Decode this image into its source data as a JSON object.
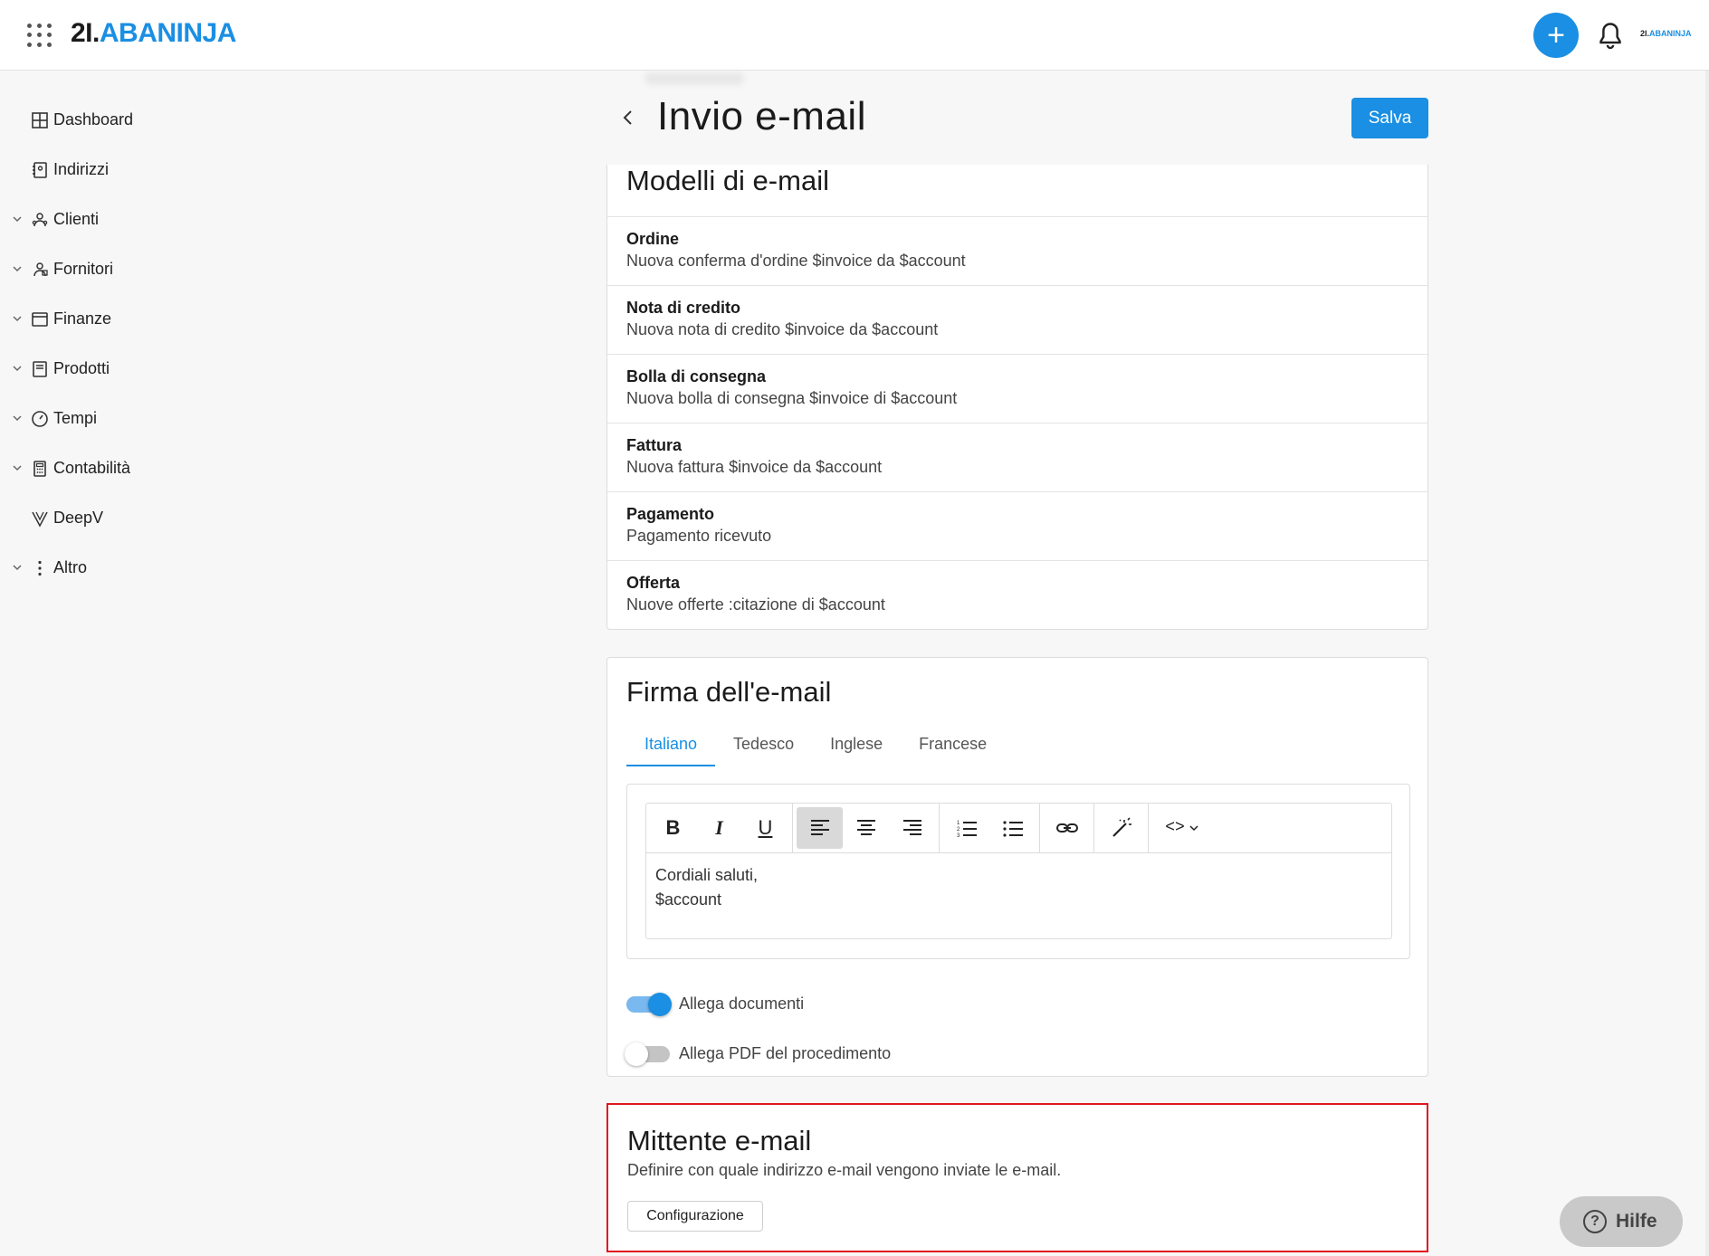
{
  "header": {
    "logo_prefix": "2I.",
    "logo_brand": "ABANINJA",
    "mini_logo_prefix": "2I.",
    "mini_logo_brand": "ABANINJA",
    "add_label": "+"
  },
  "sidebar": {
    "items": [
      {
        "label": "Dashboard",
        "icon": "dashboard-icon",
        "expandable": false
      },
      {
        "label": "Indirizzi",
        "icon": "address-book-icon",
        "expandable": false
      },
      {
        "label": "Clienti",
        "icon": "customers-icon",
        "expandable": true
      },
      {
        "label": "Fornitori",
        "icon": "suppliers-icon",
        "expandable": true
      },
      {
        "label": "Finanze",
        "icon": "finance-icon",
        "expandable": true
      },
      {
        "label": "Prodotti",
        "icon": "products-icon",
        "expandable": true
      },
      {
        "label": "Tempi",
        "icon": "clock-icon",
        "expandable": true
      },
      {
        "label": "Contabilità",
        "icon": "calculator-icon",
        "expandable": true
      },
      {
        "label": "DeepV",
        "icon": "deepv-icon",
        "expandable": false
      },
      {
        "label": "Altro",
        "icon": "more-vertical-icon",
        "expandable": true
      }
    ]
  },
  "page": {
    "title": "Invio e-mail",
    "save_label": "Salva"
  },
  "templates": {
    "title": "Modelli di e-mail",
    "rows": [
      {
        "name": "Ordine",
        "subject": "Nuova conferma d'ordine $invoice da $account"
      },
      {
        "name": "Nota di credito",
        "subject": "Nuova nota di credito $invoice da $account"
      },
      {
        "name": "Bolla di consegna",
        "subject": "Nuova bolla di consegna $invoice di $account"
      },
      {
        "name": "Fattura",
        "subject": "Nuova fattura $invoice da $account"
      },
      {
        "name": "Pagamento",
        "subject": "Pagamento ricevuto"
      },
      {
        "name": "Offerta",
        "subject": "Nuove offerte :citazione di $account"
      }
    ]
  },
  "signature": {
    "title": "Firma dell'e-mail",
    "tabs": [
      {
        "label": "Italiano",
        "active": true
      },
      {
        "label": "Tedesco",
        "active": false
      },
      {
        "label": "Inglese",
        "active": false
      },
      {
        "label": "Francese",
        "active": false
      }
    ],
    "toolbar": {
      "bold": "B",
      "italic": "I",
      "underline": "U",
      "code_label": "<>"
    },
    "text_line1": "Cordiali saluti,",
    "text_line2": "$account",
    "toggles": [
      {
        "label": "Allega documenti",
        "on": true
      },
      {
        "label": "Allega PDF del procedimento",
        "on": false
      }
    ]
  },
  "sender": {
    "title": "Mittente e-mail",
    "description": "Definire con quale indirizzo e-mail vengono inviate le e-mail.",
    "button_label": "Configurazione"
  },
  "help": {
    "icon_glyph": "?",
    "label": "Hilfe"
  },
  "colors": {
    "accent": "#1a8fe3",
    "highlight_border": "#e0161f"
  }
}
